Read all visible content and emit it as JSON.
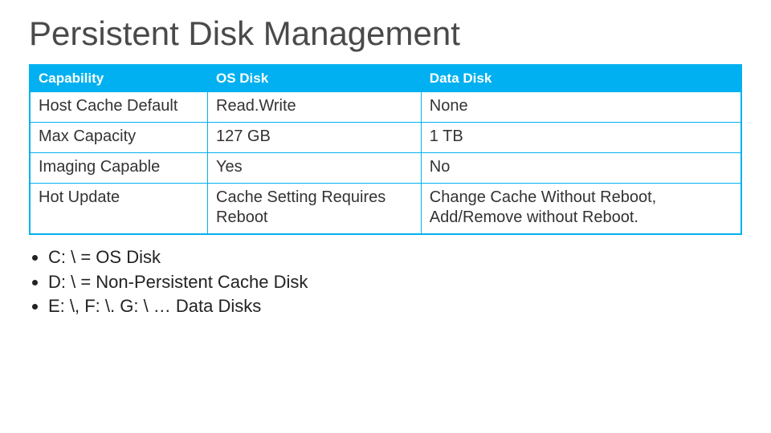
{
  "title": "Persistent Disk Management",
  "table": {
    "headers": [
      "Capability",
      "OS Disk",
      "Data Disk"
    ],
    "rows": [
      {
        "capability": "Host Cache Default",
        "os": "Read.Write",
        "data": "None"
      },
      {
        "capability": "Max Capacity",
        "os": "127 GB",
        "data": "1 TB"
      },
      {
        "capability": "Imaging Capable",
        "os": "Yes",
        "data": "No"
      },
      {
        "capability": "Hot Update",
        "os": "Cache Setting Requires Reboot",
        "data": "Change Cache Without Reboot, Add/Remove without Reboot."
      }
    ]
  },
  "notes": [
    "C: \\ = OS Disk",
    "D: \\ = Non-Persistent Cache Disk",
    "E: \\, F: \\. G: \\ … Data Disks"
  ]
}
